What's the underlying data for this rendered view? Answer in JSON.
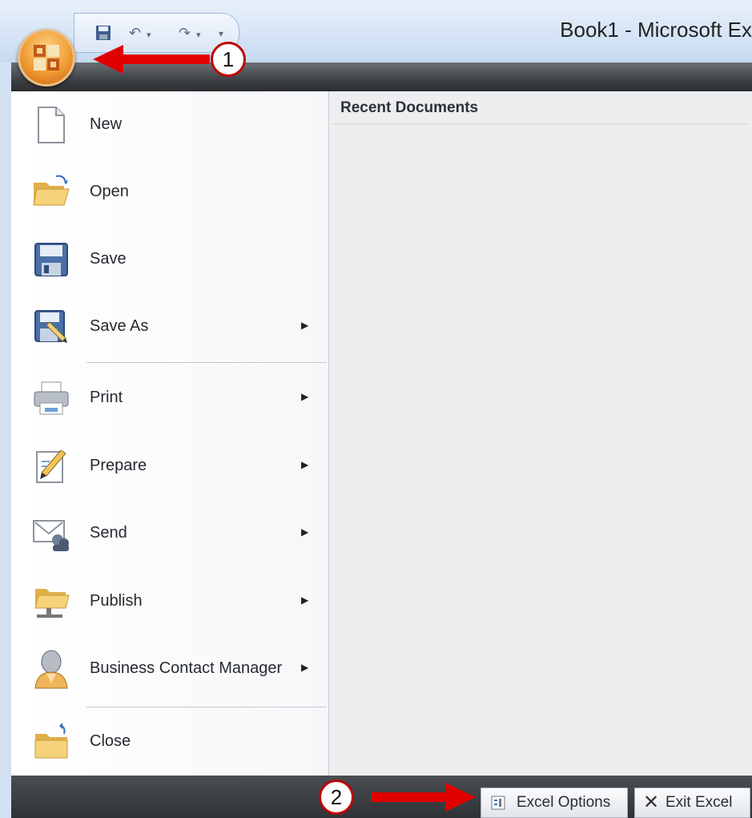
{
  "window": {
    "title": "Book1 - Microsoft Ex"
  },
  "quick_access": {
    "icons": [
      "save-icon",
      "undo-icon",
      "redo-icon",
      "customize-icon"
    ]
  },
  "office_button": {
    "icon": "office-logo-icon"
  },
  "recent": {
    "title": "Recent Documents"
  },
  "menu": {
    "items": [
      {
        "label": "New",
        "icon": "new-document-icon",
        "submenu": false
      },
      {
        "label": "Open",
        "icon": "open-folder-icon",
        "submenu": false
      },
      {
        "label": "Save",
        "icon": "save-disk-icon",
        "submenu": false
      },
      {
        "label": "Save As",
        "icon": "save-as-icon",
        "submenu": true
      },
      {
        "label": "Print",
        "icon": "printer-icon",
        "submenu": true
      },
      {
        "label": "Prepare",
        "icon": "prepare-pencil-icon",
        "submenu": true
      },
      {
        "label": "Send",
        "icon": "send-icon",
        "submenu": true
      },
      {
        "label": "Publish",
        "icon": "publish-folder-icon",
        "submenu": true
      },
      {
        "label": "Business Contact Manager",
        "icon": "contact-person-icon",
        "submenu": true
      },
      {
        "label": "Close",
        "icon": "close-folder-icon",
        "submenu": false
      }
    ]
  },
  "footer": {
    "options_label": "Excel Options",
    "exit_label": "Exit Excel"
  },
  "callouts": {
    "one": "1",
    "two": "2"
  },
  "colors": {
    "arrow": "#e00000",
    "office_orange": "#f3a33b",
    "dark_strip": "#3e4246"
  }
}
